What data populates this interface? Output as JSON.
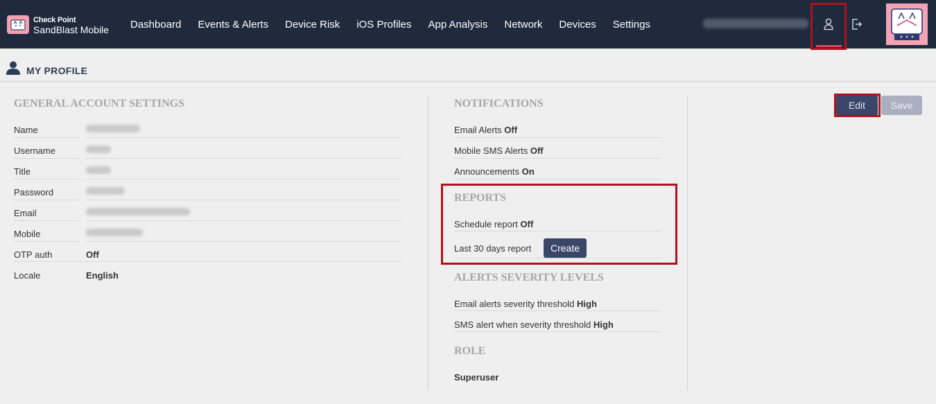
{
  "brand": {
    "small": "Check Point",
    "main": "SandBlast Mobile"
  },
  "nav": [
    "Dashboard",
    "Events & Alerts",
    "Device Risk",
    "iOS Profiles",
    "App Analysis",
    "Network",
    "Devices",
    "Settings"
  ],
  "page": {
    "title": "MY PROFILE"
  },
  "general": {
    "title": "GENERAL ACCOUNT SETTINGS",
    "labels": {
      "name": "Name",
      "username": "Username",
      "title": "Title",
      "password": "Password",
      "email": "Email",
      "mobile": "Mobile",
      "otp": "OTP auth",
      "locale": "Locale"
    },
    "values": {
      "otp": "Off",
      "locale": "English"
    }
  },
  "notifications": {
    "title": "NOTIFICATIONS",
    "email_label": "Email Alerts",
    "email_value": "Off",
    "sms_label": "Mobile SMS Alerts",
    "sms_value": "Off",
    "ann_label": "Announcements",
    "ann_value": "On"
  },
  "reports": {
    "title": "REPORTS",
    "schedule_label": "Schedule report",
    "schedule_value": "Off",
    "last30_label": "Last 30 days report",
    "create_label": "Create"
  },
  "severity": {
    "title": "ALERTS SEVERITY LEVELS",
    "email_label": "Email alerts severity threshold",
    "email_value": "High",
    "sms_label": "SMS alert when severity threshold",
    "sms_value": "High"
  },
  "role": {
    "title": "ROLE",
    "value": "Superuser"
  },
  "actions": {
    "edit": "Edit",
    "save": "Save"
  },
  "colors": {
    "topbar": "#1f2a3d",
    "accent": "#3b4668",
    "highlight": "#b0121a"
  },
  "icons": {
    "logo": "cat-logo-icon",
    "user": "user-icon",
    "logout": "logout-icon",
    "profile": "person-icon"
  }
}
